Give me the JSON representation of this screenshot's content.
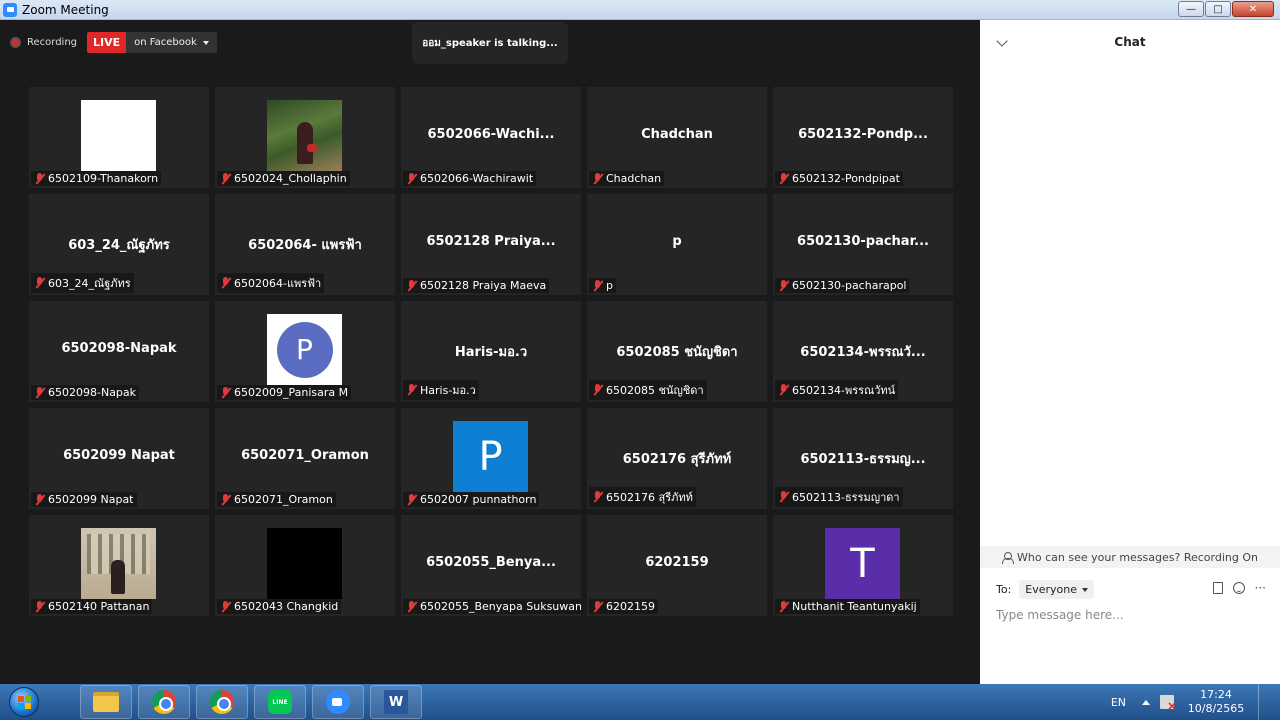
{
  "window": {
    "title": "Zoom Meeting"
  },
  "meeting": {
    "recording_label": "Recording",
    "live_badge": "LIVE",
    "live_destination": "on Facebook",
    "talking_indicator": "ออม_speaker  is  talking...",
    "participants": [
      {
        "display": "",
        "label": "6502109-Thanakorn",
        "avatar": "white"
      },
      {
        "display": "",
        "label": "6502024_Chollaphin",
        "avatar": "photo-jungle"
      },
      {
        "display": "6502066-Wachi...",
        "label": "6502066-Wachirawit",
        "avatar": "none"
      },
      {
        "display": "Chadchan",
        "label": "Chadchan",
        "avatar": "none"
      },
      {
        "display": "6502132-Pondp...",
        "label": "6502132-Pondpipat",
        "avatar": "none"
      },
      {
        "display": "603_24_ณัฐภัทร",
        "label": "603_24_ณัฐภัทร",
        "avatar": "none"
      },
      {
        "display": "6502064- แพรฟ้า",
        "label": "6502064-แพรฟ้า",
        "avatar": "none"
      },
      {
        "display": "6502128 Praiya...",
        "label": "6502128 Praiya Maeva",
        "avatar": "none"
      },
      {
        "display": "p",
        "label": "p",
        "avatar": "none"
      },
      {
        "display": "6502130-pachar...",
        "label": "6502130-pacharapol",
        "avatar": "none"
      },
      {
        "display": "6502098-Napak",
        "label": "6502098-Napak",
        "avatar": "none"
      },
      {
        "display": "",
        "label": "6502009_Panisara M",
        "avatar": "letter-circle",
        "letter": "P"
      },
      {
        "display": "Haris-มอ.ว",
        "label": "Haris-มอ.ว",
        "avatar": "none"
      },
      {
        "display": "6502085 ชนัญชิดา",
        "label": "6502085 ชนัญชิดา",
        "avatar": "none"
      },
      {
        "display": "6502134-พรรณวั...",
        "label": "6502134-พรรณวัทน์",
        "avatar": "none"
      },
      {
        "display": "6502099 Napat",
        "label": "6502099 Napat",
        "avatar": "none"
      },
      {
        "display": "6502071_Oramon",
        "label": "6502071_Oramon",
        "avatar": "none"
      },
      {
        "display": "",
        "label": "6502007 punnathorn",
        "avatar": "blue-block",
        "letter": "P"
      },
      {
        "display": "6502176 สุรีภัทท์",
        "label": "6502176 สุรีภัทท์",
        "avatar": "none"
      },
      {
        "display": "6502113-ธรรมญ...",
        "label": "6502113-ธรรมญาดา",
        "avatar": "none"
      },
      {
        "display": "",
        "label": "6502140 Pattanan",
        "avatar": "photo-building"
      },
      {
        "display": "",
        "label": "6502043 Changkid",
        "avatar": "black"
      },
      {
        "display": "6502055_Benya...",
        "label": "6502055_Benyapa Suksuwan",
        "avatar": "none"
      },
      {
        "display": "6202159",
        "label": "6202159",
        "avatar": "none"
      },
      {
        "display": "",
        "label": "Nutthanit Teantunyakij",
        "avatar": "purple-block",
        "letter": "T"
      }
    ]
  },
  "chat": {
    "title": "Chat",
    "visibility_notice": "Who can see your messages? Recording On",
    "to_label": "To:",
    "to_value": "Everyone",
    "input_placeholder": "Type message here..."
  },
  "taskbar": {
    "language": "EN",
    "time": "17:24",
    "date": "10/8/2565",
    "word_letter": "W",
    "line_text": "LINE"
  },
  "colors": {
    "live": "#e02828",
    "zoom_blue": "#2d8cff",
    "tile_bg": "#252525"
  }
}
